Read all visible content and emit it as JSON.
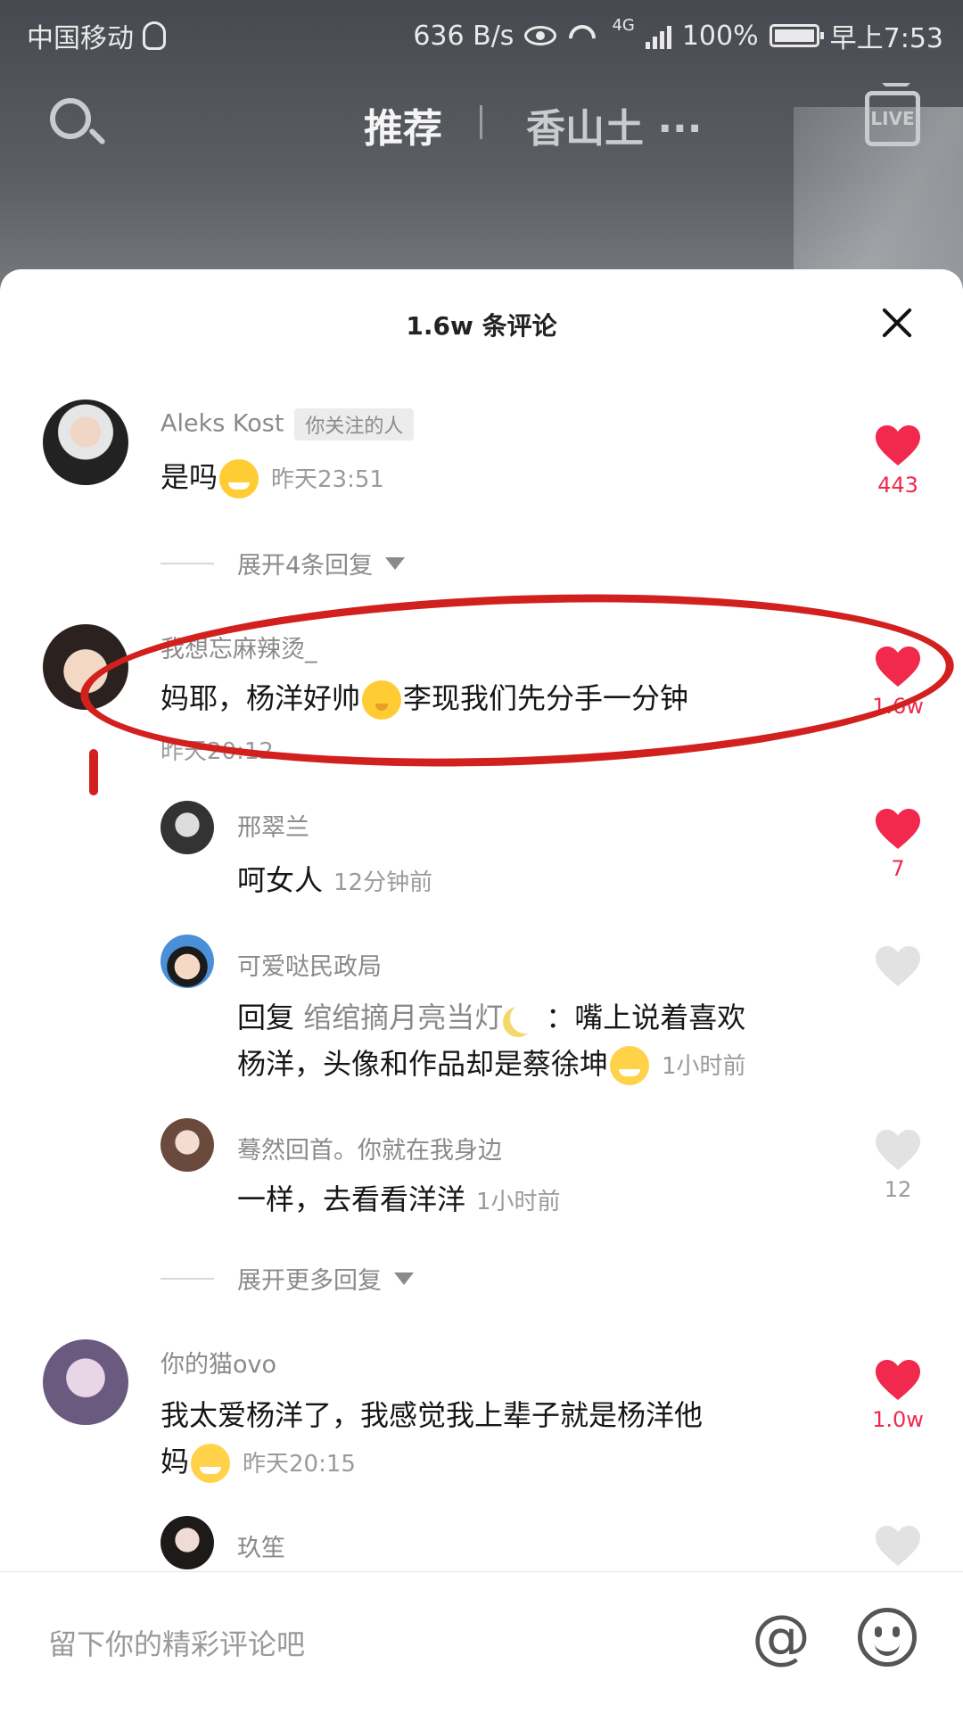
{
  "statusbar": {
    "carrier": "中国移动",
    "net_speed": "636 B/s",
    "network": "4G",
    "battery": "100%",
    "time": "早上7:53"
  },
  "topnav": {
    "tab_recommend": "推荐",
    "tab_city": "香山土 ···",
    "live_label": "LIVE"
  },
  "sheet": {
    "title": "1.6w 条评论"
  },
  "comments": [
    {
      "user": "Aleks Kost",
      "tag": "你关注的人",
      "text": "是吗",
      "time": "昨天23:51",
      "likes": "443",
      "liked": true,
      "expand": "展开4条回复"
    },
    {
      "user": "我想忘麻辣烫_",
      "text": "妈耶，杨洋好帅",
      "text2": "李现我们先分手一分钟",
      "time": "昨天20:12",
      "likes": "1.6w",
      "liked": true
    },
    {
      "user": "你的猫ovo",
      "text": "我太爱杨洋了，我感觉我上辈子就是杨洋他",
      "text2": "妈",
      "time": "昨天20:15",
      "likes": "1.0w",
      "liked": true
    },
    {
      "user": "玖笙"
    }
  ],
  "replies": [
    {
      "user": "邢翠兰",
      "text": "呵女人",
      "time": "12分钟前",
      "likes": "7",
      "liked": true
    },
    {
      "user": "可爱哒民政局",
      "prefix": "回复",
      "target": "绾绾摘月亮当灯",
      "text": "：嘴上说着喜欢",
      "text2": "杨洋，头像和作品却是蔡徐坤",
      "time": "1小时前",
      "likes": "",
      "liked": false
    },
    {
      "user": "蓦然回首。你就在我身边",
      "text": "一样，去看看洋洋",
      "time": "1小时前",
      "likes": "12",
      "liked": false
    }
  ],
  "expand_more": "展开更多回复",
  "input": {
    "placeholder": "留下你的精彩评论吧"
  },
  "colors": {
    "like_red": "#f0294d",
    "like_grey": "#e2e2e2",
    "annotation_red": "#d2201e"
  }
}
